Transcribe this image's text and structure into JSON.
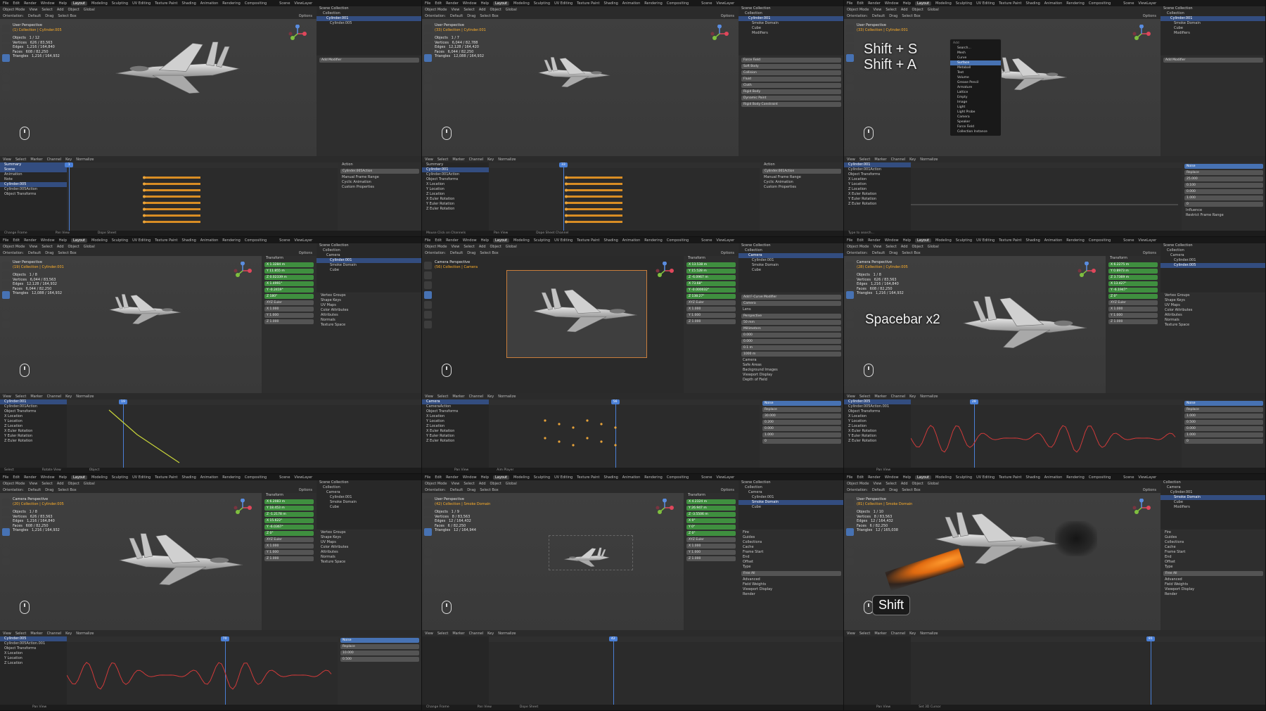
{
  "menus": [
    "File",
    "Edit",
    "Render",
    "Window",
    "Help"
  ],
  "workspace_tabs": [
    "Layout",
    "Modeling",
    "Sculpting",
    "UV Editing",
    "Texture Paint",
    "Shading",
    "Animation",
    "Rendering",
    "Compositing"
  ],
  "scene_label": "Scene",
  "viewlayer_label": "ViewLayer",
  "header": {
    "mode": "Object Mode",
    "view": "View",
    "select": "Select",
    "add": "Add",
    "object": "Object",
    "orientation": "Orientation:",
    "default": "Default",
    "drag": "Drag",
    "select_box": "Select Box",
    "options": "Options",
    "global": "Global"
  },
  "graph_menu": {
    "view": "View",
    "select": "Select",
    "marker": "Marker",
    "channel": "Channel",
    "key": "Key",
    "normalize": "Normalize"
  },
  "playback": {
    "playback": "Playback",
    "keying": "Keying",
    "view": "View",
    "marker": "Marker",
    "start": "Start",
    "end": "End"
  },
  "panels": [
    {
      "id": "p1",
      "perspective": "User Perspective",
      "collection": "(1) Collection | Cylinder.005",
      "stats": "Objects   1 / 12\nVertices   626 / 83,563\nEdges   1,216 / 164,840\nFaces   608 / 82,250\nTriangles   1,216 / 164,932",
      "outliner": [
        {
          "t": "Scene Collection",
          "h": false
        },
        {
          "t": "Collection",
          "h": false
        },
        {
          "t": "Cylinder.001",
          "h": true
        },
        {
          "t": "Cylinder.005",
          "h": false
        }
      ],
      "add_modifier": "Add Modifier",
      "frame": "1",
      "start": "1",
      "end": "250",
      "channels": [
        {
          "t": "Summary",
          "h": true
        },
        {
          "t": "Scene",
          "h": true
        },
        {
          "t": "Animation",
          "h": false
        },
        {
          "t": "Note",
          "h": false
        },
        {
          "t": "Cylinder.005",
          "h": true
        },
        {
          "t": "Cylinder.005Action",
          "h": false
        },
        {
          "t": "Object Transforms",
          "h": false
        }
      ],
      "action_panel": [
        "Action",
        "Cylinder.005Action",
        "Manual Frame Range",
        "Cyclic Animation",
        "Custom Properties"
      ],
      "status": [
        "Change Frame",
        "Pan View",
        "Dope Sheet"
      ]
    },
    {
      "id": "p2",
      "perspective": "User Perspective",
      "collection": "(33) Collection | Cylinder.001",
      "stats": "Objects   1 / 7\nVertices   6,044 / 82,788\nEdges   12,128 / 164,420\nFaces   6,044 / 82,250\nTriangles   12,088 / 164,932",
      "outliner": [
        {
          "t": "Scene Collection",
          "h": false
        },
        {
          "t": "Collection",
          "h": false
        },
        {
          "t": "Cylinder.001",
          "h": true
        },
        {
          "t": "Smoke Domain",
          "h": false
        },
        {
          "t": "Cube",
          "h": false
        },
        {
          "t": "Modifiers",
          "h": false
        }
      ],
      "physics": [
        "Force Field",
        "Soft Body",
        "Collision",
        "Fluid",
        "Cloth",
        "Rigid Body",
        "Dynamic Paint",
        "Rigid Body Constraint"
      ],
      "frame": "33",
      "start": "1",
      "end": "100",
      "channels": [
        {
          "t": "Summary",
          "h": false
        },
        {
          "t": "Cylinder.001",
          "h": true
        },
        {
          "t": "Cylinder.001Action",
          "h": false
        },
        {
          "t": "Object Transforms",
          "h": false
        },
        {
          "t": "X Location",
          "h": false
        },
        {
          "t": "Y Location",
          "h": false
        },
        {
          "t": "Z Location",
          "h": false
        },
        {
          "t": "X Euler Rotation",
          "h": false
        },
        {
          "t": "Y Euler Rotation",
          "h": false
        },
        {
          "t": "Z Euler Rotation",
          "h": false
        }
      ],
      "action_panel": [
        "Action",
        "Cylinder.001Action",
        "Manual Frame Range",
        "Cyclic Animation",
        "Custom Properties"
      ],
      "status": [
        "Mouse Click on Channels",
        "Pan View",
        "Dope Sheet Channel"
      ]
    },
    {
      "id": "p3",
      "perspective": "User Perspective",
      "collection": "(33) Collection | Cylinder.001",
      "overlay": "Shift + S\nShift + A",
      "add_menu": {
        "title": "Add",
        "search": "Search...",
        "items": [
          "Mesh",
          "Curve",
          "Surface",
          "Metaball",
          "Text",
          "Volume",
          "Grease Pencil",
          "Armature",
          "Lattice",
          "Empty",
          "Image",
          "Light",
          "Light Probe",
          "Camera",
          "Speaker",
          "Force Field",
          "Collection Instance"
        ],
        "highlight": "Surface"
      },
      "outliner": [
        {
          "t": "Scene Collection",
          "h": false
        },
        {
          "t": "Collection",
          "h": false
        },
        {
          "t": "Cylinder.001",
          "h": true
        },
        {
          "t": "Smoke Domain",
          "h": false
        },
        {
          "t": "Cube",
          "h": false
        },
        {
          "t": "Modifiers",
          "h": false
        }
      ],
      "add_modifier": "Add Modifier",
      "channels": [
        {
          "t": "Cylinder.001",
          "h": true
        },
        {
          "t": "Cylinder.001Action",
          "h": false
        },
        {
          "t": "Object Transforms",
          "h": false
        },
        {
          "t": "X Location",
          "h": false
        },
        {
          "t": "Y Location",
          "h": false
        },
        {
          "t": "Z Location",
          "h": false
        },
        {
          "t": "X Euler Rotation",
          "h": false
        },
        {
          "t": "Y Euler Rotation",
          "h": false
        },
        {
          "t": "Z Euler Rotation",
          "h": false
        }
      ],
      "modifier": {
        "name": "Noise",
        "blend_type": "Replace",
        "fields": [
          {
            "l": "Scale",
            "v": "25.000"
          },
          {
            "l": "Strength",
            "v": "0.100"
          },
          {
            "l": "Offset",
            "v": "0.000"
          },
          {
            "l": "Phase",
            "v": "1.000"
          },
          {
            "l": "Depth",
            "v": "0"
          }
        ],
        "influence": "Influence",
        "restrict": "Restrict Frame Range"
      },
      "status": [
        "Type to search...",
        "",
        ""
      ]
    },
    {
      "id": "p4",
      "perspective": "User Perspective",
      "collection": "(19) Collection | Cylinder.001",
      "stats": "Objects   1 / 8\nVertices   6,044 / 83,563\nEdges   12,128 / 164,932\nFaces   6,044 / 82,250\nTriangles   12,088 / 164,932",
      "transform": {
        "title": "Transform",
        "location": [
          "X 1.3284 m",
          "Y 11.855 m",
          "Z 0.02339 m"
        ],
        "rotation": [
          "X 1.4991°",
          "Y -0.2419°",
          "Z 180°"
        ],
        "mode": "XYZ Euler",
        "scale": [
          "X 1.000",
          "Y 1.000",
          "Z 1.000"
        ]
      },
      "outliner": [
        {
          "t": "Scene Collection",
          "h": false
        },
        {
          "t": "Collection",
          "h": false
        },
        {
          "t": "Camera",
          "h": false
        },
        {
          "t": "Cylinder.001",
          "h": true
        },
        {
          "t": "Smoke Domain",
          "h": false
        },
        {
          "t": "Cube",
          "h": false
        }
      ],
      "props_sections": [
        "Vertex Groups",
        "Shape Keys",
        "UV Maps",
        "Color Attributes",
        "Attributes",
        "Normals",
        "Texture Space"
      ],
      "frame": "19",
      "channels": [
        {
          "t": "Cylinder.001",
          "h": true
        },
        {
          "t": "Cylinder.001Action",
          "h": false
        },
        {
          "t": "Object Transforms",
          "h": false
        },
        {
          "t": "X Location",
          "h": false
        },
        {
          "t": "Y Location",
          "h": false
        },
        {
          "t": "Z Location",
          "h": false
        },
        {
          "t": "X Euler Rotation",
          "h": false
        },
        {
          "t": "Y Euler Rotation",
          "h": false
        },
        {
          "t": "Z Euler Rotation",
          "h": false
        }
      ],
      "status": [
        "Select",
        "Rotate View",
        "Object"
      ]
    },
    {
      "id": "p5",
      "perspective": "Camera Perspective",
      "collection": "(56) Collection | Camera",
      "transform": {
        "title": "Transform",
        "location": [
          "X 13.538 m",
          "Y 15.528 m",
          "Z -6.0967 m"
        ],
        "rotation": [
          "X 73.68°",
          "Y -0.000032°",
          "Z 138.27°"
        ],
        "mode": "XYZ Euler",
        "scale": [
          "X 1.000",
          "Y 1.000",
          "Z 1.000"
        ]
      },
      "outliner": [
        {
          "t": "Scene Collection",
          "h": false
        },
        {
          "t": "Collection",
          "h": false
        },
        {
          "t": "Camera",
          "h": true
        },
        {
          "t": "Cylinder.001",
          "h": false
        },
        {
          "t": "Smoke Domain",
          "h": false
        },
        {
          "t": "Cube",
          "h": false
        }
      ],
      "camera_props": {
        "name": "Camera",
        "lens": "Lens",
        "type": "Perspective",
        "focal": "50 mm",
        "units": "Millimeters",
        "shift_x": "0.000",
        "shift_y": "0.000",
        "clip_start": "0.1 m",
        "end": "1000 m",
        "sections": [
          "Camera",
          "Safe Areas",
          "Background Images",
          "Viewport Display",
          "Depth of Field"
        ]
      },
      "frame": "56",
      "channels": [
        {
          "t": "Camera",
          "h": true
        },
        {
          "t": "CameraAction",
          "h": false
        },
        {
          "t": "Object Transforms",
          "h": false
        },
        {
          "t": "X Location",
          "h": false
        },
        {
          "t": "Y Location",
          "h": false
        },
        {
          "t": "Z Location",
          "h": false
        },
        {
          "t": "X Euler Rotation",
          "h": false
        },
        {
          "t": "Y Euler Rotation",
          "h": false
        },
        {
          "t": "Z Euler Rotation",
          "h": false
        }
      ],
      "modifier": {
        "name": "Noise",
        "blend_type": "Replace",
        "fields": [
          {
            "l": "Scale",
            "v": "30.000"
          },
          {
            "l": "Strength",
            "v": "0.200"
          },
          {
            "l": "Offset",
            "v": "0.000"
          },
          {
            "l": "Phase",
            "v": "1.000"
          },
          {
            "l": "Depth",
            "v": "0"
          }
        ]
      },
      "add_modifier": "Add F-Curve Modifier",
      "status": [
        "",
        "Pan View",
        "Aim Player"
      ]
    },
    {
      "id": "p6",
      "perspective": "Camera Perspective",
      "collection": "(28) Collection | Cylinder.005",
      "stats": "Objects   1 / 8\nVertices   626 / 83,563\nEdges   1,216 / 164,840\nFaces   608 / 82,250\nTriangles   1,216 / 164,932",
      "overlay": "Spacebar x2",
      "transform": {
        "title": "Transform",
        "location": [
          "X 6.2275 m",
          "Y 0.8973 m",
          "Z 3.7369 m"
        ],
        "rotation": [
          "X 13.427°",
          "Y -6.1947°",
          "Z 0°"
        ],
        "mode": "XYZ Euler",
        "scale": [
          "X 1.000",
          "Y 1.000",
          "Z 1.000"
        ]
      },
      "outliner": [
        {
          "t": "Scene Collection",
          "h": false
        },
        {
          "t": "Collection",
          "h": false
        },
        {
          "t": "Camera",
          "h": false
        },
        {
          "t": "Cylinder.001",
          "h": false
        },
        {
          "t": "Cylinder.005",
          "h": true
        }
      ],
      "props_sections": [
        "Vertex Groups",
        "Shape Keys",
        "UV Maps",
        "Color Attributes",
        "Attributes",
        "Normals",
        "Texture Space"
      ],
      "frame": "28",
      "channels": [
        {
          "t": "Cylinder.005",
          "h": true
        },
        {
          "t": "Cylinder.005Action.001",
          "h": false
        },
        {
          "t": "Object Transforms",
          "h": false
        },
        {
          "t": "X Location",
          "h": false
        },
        {
          "t": "Y Location",
          "h": false
        },
        {
          "t": "Z Location",
          "h": false
        },
        {
          "t": "X Euler Rotation",
          "h": false
        },
        {
          "t": "Y Euler Rotation",
          "h": false
        },
        {
          "t": "Z Euler Rotation",
          "h": false
        }
      ],
      "modifier": {
        "name": "Noise",
        "blend_type": "Replace",
        "fields": [
          {
            "l": "Scale",
            "v": "1.000"
          },
          {
            "l": "Strength",
            "v": "0.500"
          },
          {
            "l": "Offset",
            "v": "0.000"
          },
          {
            "l": "Phase",
            "v": "1.000"
          },
          {
            "l": "Depth",
            "v": "0"
          }
        ]
      },
      "status": [
        "",
        "Pan View",
        ""
      ]
    },
    {
      "id": "p7",
      "perspective": "Camera Perspective",
      "collection": "(20) Collection | Cylinder.005",
      "stats": "Objects   1 / 8\nVertices   626 / 83,563\nEdges   1,216 / 164,840\nFaces   608 / 82,250\nTriangles   1,216 / 164,932",
      "transform": {
        "title": "Transform",
        "location": [
          "X 6.2083 m",
          "Y 18.453 m",
          "Z -1.2178 m"
        ],
        "rotation": [
          "X 15.622°",
          "Y -6.0367°",
          "Z 0°"
        ],
        "mode": "XYZ Euler",
        "scale": [
          "X 1.000",
          "Y 1.000",
          "Z 1.000"
        ]
      },
      "outliner": [
        {
          "t": "Scene Collection",
          "h": false
        },
        {
          "t": "Collection",
          "h": false
        },
        {
          "t": "Camera",
          "h": false
        },
        {
          "t": "Cylinder.001",
          "h": false
        },
        {
          "t": "Smoke Domain",
          "h": false
        },
        {
          "t": "Cube",
          "h": false
        }
      ],
      "props_sections": [
        "Vertex Groups",
        "Shape Keys",
        "UV Maps",
        "Color Attributes",
        "Attributes",
        "Normals",
        "Texture Space"
      ],
      "frame": "70",
      "channels": [
        {
          "t": "Cylinder.005",
          "h": true
        },
        {
          "t": "Cylinder.005Action.001",
          "h": false
        },
        {
          "t": "Object Transforms",
          "h": false
        },
        {
          "t": "X Location",
          "h": false
        },
        {
          "t": "Y Location",
          "h": false
        },
        {
          "t": "Z Location",
          "h": false
        }
      ],
      "modifier": {
        "name": "Noise",
        "blend_type": "Replace",
        "fields": [
          {
            "l": "Scale",
            "v": "10.000"
          },
          {
            "l": "Strength",
            "v": "0.500"
          }
        ]
      },
      "status": [
        "",
        "Pan View",
        ""
      ]
    },
    {
      "id": "p8",
      "perspective": "User Perspective",
      "collection": "(42) Collection | Smoke Domain",
      "stats": "Objects   1 / 9\nVertices   8 / 83,563\nEdges   12 / 164,432\nFaces   6 / 82,250\nTriangles   12 / 164,944",
      "transform": {
        "title": "Transform",
        "location": [
          "X 4.2324 m",
          "Y 26.947 m",
          "Z -3.5506 m"
        ],
        "rotation": [
          "X 0°",
          "Y 0°",
          "Z 0°"
        ],
        "mode": "XYZ Euler",
        "scale": [
          "X 1.000",
          "Y 1.000",
          "Z 1.000"
        ]
      },
      "outliner": [
        {
          "t": "Scene Collection",
          "h": false
        },
        {
          "t": "Collection",
          "h": false
        },
        {
          "t": "Camera",
          "h": false
        },
        {
          "t": "Cylinder.001",
          "h": false
        },
        {
          "t": "Smoke Domain",
          "h": true
        },
        {
          "t": "Cube",
          "h": false
        }
      ],
      "fluid_props": [
        "Fire",
        "Guides",
        "Collections",
        "Cache",
        "Frame Start",
        "End",
        "Offset",
        "Type",
        "Free All",
        "Advanced",
        "Field Weights",
        "Viewport Display",
        "Render"
      ],
      "frame": "42",
      "channels": [],
      "status": [
        "Change Frame",
        "Pan View",
        "Dope Sheet"
      ]
    },
    {
      "id": "p9",
      "perspective": "User Perspective",
      "collection": "(81) Collection | Smoke Domain",
      "stats": "Objects   1 / 10\nVertices   8 / 83,563\nEdges   12 / 164,432\nFaces   6 / 82,250\nTriangles   12 / 165,038",
      "overlay": "Shift",
      "outliner": [
        {
          "t": "Collection",
          "h": false
        },
        {
          "t": "Camera",
          "h": false
        },
        {
          "t": "Cylinder.001",
          "h": false
        },
        {
          "t": "Smoke Domain",
          "h": true
        },
        {
          "t": "Cube",
          "h": false
        },
        {
          "t": "Modifiers",
          "h": false
        }
      ],
      "fluid_props": [
        "Fire",
        "Guides",
        "Collections",
        "Cache",
        "Frame Start",
        "End",
        "Offset",
        "Type",
        "Free All",
        "Advanced",
        "Field Weights",
        "Viewport Display",
        "Render"
      ],
      "frame": "81",
      "channels": [],
      "status": [
        "",
        "Pan View",
        "Set 3D Cursor"
      ]
    }
  ],
  "colors": {
    "accent": "#4772b3",
    "keyframe": "#e8a33a",
    "selected": "#ffaf29",
    "field_green": "#3f8f3f",
    "fire": "#ff8c1a"
  }
}
